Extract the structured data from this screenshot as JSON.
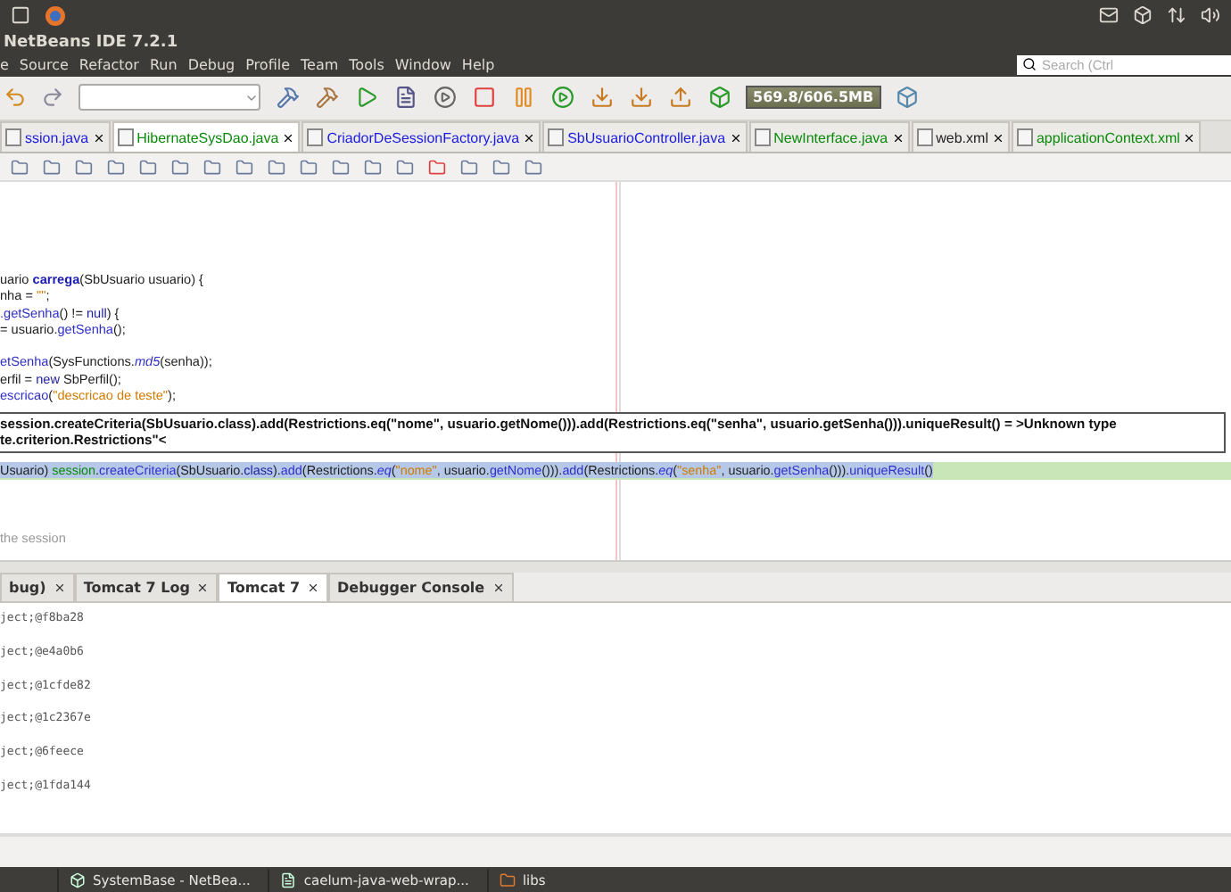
{
  "window": {
    "title": "NetBeans IDE 7.2.1"
  },
  "menu": [
    "e",
    "Source",
    "Refactor",
    "Run",
    "Debug",
    "Profile",
    "Team",
    "Tools",
    "Window",
    "Help"
  ],
  "search": {
    "placeholder": "Search (Ctrl"
  },
  "memory": {
    "reading": "569.8/606.5MB"
  },
  "editor_tabs": [
    {
      "label": "ssion.java",
      "selected": false,
      "color": "#1a1ae0"
    },
    {
      "label": "HibernateSysDao.java",
      "selected": true,
      "color": "#0a8a0a"
    },
    {
      "label": "CriadorDeSessionFactory.java",
      "selected": false,
      "color": "#1a1ae0"
    },
    {
      "label": "SbUsuarioController.java",
      "selected": false,
      "color": "#1a1ae0"
    },
    {
      "label": "NewInterface.java",
      "selected": false,
      "color": "#0a8a0a"
    },
    {
      "label": "web.xml",
      "selected": false,
      "color": "#222222"
    },
    {
      "label": "applicationContext.xml",
      "selected": false,
      "color": "#0a8a0a"
    }
  ],
  "code_lines": [
    [
      {
        "kind": "plain",
        "text": "uario "
      },
      {
        "kind": "decl",
        "text": "carrega"
      },
      {
        "kind": "plain",
        "text": "(SbUsuario usuario) {"
      }
    ],
    [
      {
        "kind": "plain",
        "text": "nha = "
      },
      {
        "kind": "string",
        "text": "\"\""
      },
      {
        "kind": "plain",
        "text": ";"
      }
    ],
    [
      {
        "kind": "method",
        "text": ".getSenha"
      },
      {
        "kind": "plain",
        "text": "() != "
      },
      {
        "kind": "keyword",
        "text": "null"
      },
      {
        "kind": "plain",
        "text": ") {"
      }
    ],
    [
      {
        "kind": "plain",
        "text": "= usuario."
      },
      {
        "kind": "method",
        "text": "getSenha"
      },
      {
        "kind": "plain",
        "text": "();"
      }
    ],
    [
      {
        "kind": "method",
        "text": "etSenha"
      },
      {
        "kind": "plain",
        "text": "(SysFunctions."
      },
      {
        "kind": "static",
        "text": "md5"
      },
      {
        "kind": "plain",
        "text": "(senha));"
      }
    ],
    [
      {
        "kind": "plain",
        "text": "erfil = "
      },
      {
        "kind": "keyword",
        "text": "new"
      },
      {
        "kind": "plain",
        "text": " SbPerfil();"
      }
    ],
    [
      {
        "kind": "method",
        "text": "escricao"
      },
      {
        "kind": "plain",
        "text": "("
      },
      {
        "kind": "string",
        "text": "\"descricao de teste\""
      },
      {
        "kind": "plain",
        "text": ");"
      }
    ]
  ],
  "tooltip": [
    "session.createCriteria(SbUsuario.class).add(Restrictions.eq(\"nome\", usuario.getNome())).add(Restrictions.eq(\"senha\", usuario.getSenha())).uniqueResult() = >Unknown type",
    "te.criterion.Restrictions\"<"
  ],
  "current_line": [
    {
      "kind": "plain",
      "text": "Usuario) "
    },
    {
      "kind": "field",
      "text": "session"
    },
    {
      "kind": "plain",
      "text": "."
    },
    {
      "kind": "method",
      "text": "createCriteria"
    },
    {
      "kind": "plain",
      "text": "(SbUsuario."
    },
    {
      "kind": "keyword",
      "text": "class"
    },
    {
      "kind": "plain",
      "text": ")."
    },
    {
      "kind": "method",
      "text": "add"
    },
    {
      "kind": "plain",
      "text": "(Restrictions."
    },
    {
      "kind": "static",
      "text": "eq"
    },
    {
      "kind": "plain",
      "text": "("
    },
    {
      "kind": "string",
      "text": "\"nome\""
    },
    {
      "kind": "plain",
      "text": ", usuario."
    },
    {
      "kind": "method",
      "text": "getNome"
    },
    {
      "kind": "plain",
      "text": "()))."
    },
    {
      "kind": "method",
      "text": "add"
    },
    {
      "kind": "plain",
      "text": "(Restrictions."
    },
    {
      "kind": "static",
      "text": "eq"
    },
    {
      "kind": "plain",
      "text": "("
    },
    {
      "kind": "string",
      "text": "\"senha\""
    },
    {
      "kind": "plain",
      "text": ", usuario."
    },
    {
      "kind": "method",
      "text": "getSenha"
    },
    {
      "kind": "plain",
      "text": "()))."
    },
    {
      "kind": "method",
      "text": "uniqueResult"
    },
    {
      "kind": "plain",
      "text": "()"
    }
  ],
  "comment": "the session",
  "output_tabs": [
    {
      "label": "bug)",
      "selected": false
    },
    {
      "label": "Tomcat 7 Log",
      "selected": false
    },
    {
      "label": "Tomcat 7",
      "selected": true
    },
    {
      "label": "Debugger Console",
      "selected": false
    }
  ],
  "output_lines": [
    "ject;@f8ba28",
    "ject;@e4a0b6",
    "ject;@1cfde82",
    "ject;@1c2367e",
    "ject;@6feece",
    "ject;@1fda144"
  ],
  "taskbar": [
    {
      "label": "SystemBase - NetBea...",
      "kind": "app"
    },
    {
      "label": "caelum-java-web-wrap...",
      "kind": "document"
    },
    {
      "label": "libs",
      "kind": "folder"
    }
  ]
}
